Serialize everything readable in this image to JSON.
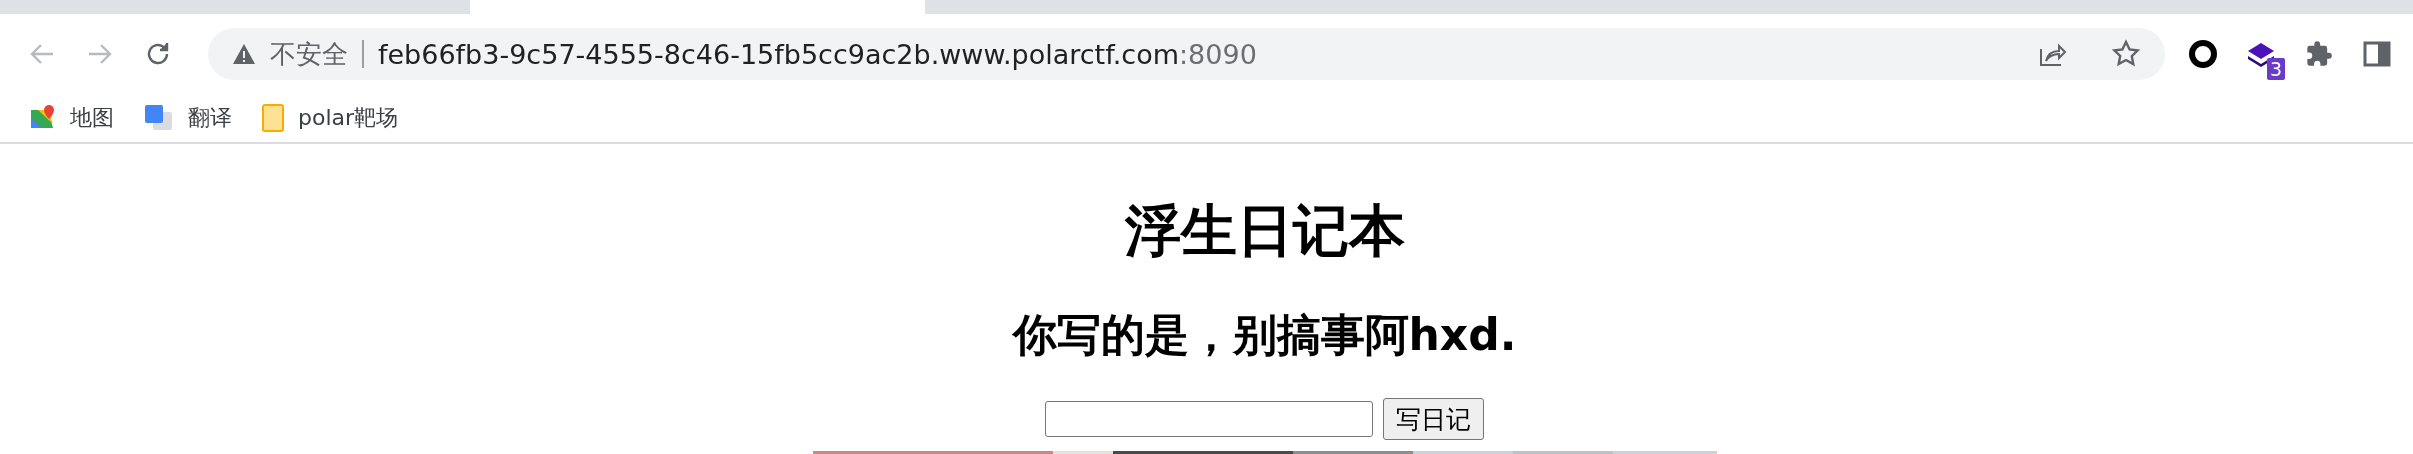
{
  "address_bar": {
    "security_label": "不安全",
    "url_host": "feb66fb3-9c57-4555-8c46-15fb5cc9ac2b.www.polarctf.com",
    "url_port": ":8090"
  },
  "extensions": [
    {
      "kind": "ring"
    },
    {
      "kind": "layers",
      "badge": "3"
    },
    {
      "kind": "puzzle"
    },
    {
      "kind": "panel"
    }
  ],
  "bookmarks": [
    {
      "kind": "maps",
      "label": "地图"
    },
    {
      "kind": "translate",
      "label": "翻译"
    },
    {
      "kind": "folder",
      "label": "polar靶场"
    }
  ],
  "page": {
    "title": "浮生日记本",
    "subtitle": "你写的是，别搞事阿hxd.",
    "button": "写日记"
  }
}
